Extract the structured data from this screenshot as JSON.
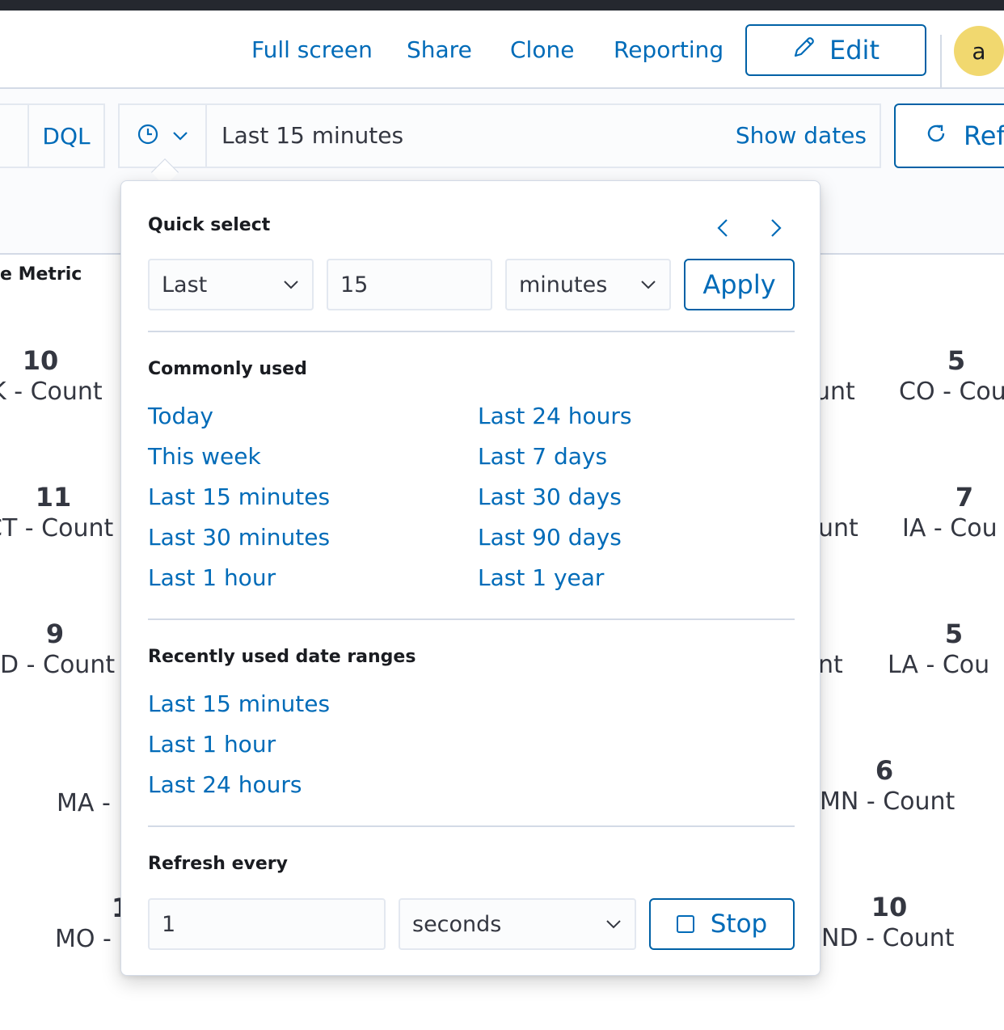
{
  "header": {
    "links": [
      "Full screen",
      "Share",
      "Clone",
      "Reporting"
    ],
    "edit_label": "Edit",
    "avatar_initial": "a"
  },
  "query_bar": {
    "language": "DQL",
    "time_range": "Last 15 minutes",
    "show_dates": "Show dates",
    "refresh_label": "Ref"
  },
  "dashboard": {
    "panel_title": "e Metric",
    "metrics": [
      {
        "value": "10",
        "label": "K - Count"
      },
      {
        "value": "11",
        "label": "CT - Count"
      },
      {
        "value": "9",
        "label": "D - Count"
      },
      {
        "value": "",
        "label": "MA -"
      },
      {
        "value": "1",
        "label": "MO -"
      },
      {
        "value": "",
        "label": "unt"
      },
      {
        "value": "",
        "label": "unt"
      },
      {
        "value": "",
        "label": "nt"
      },
      {
        "value": "6",
        "label": "MN - Count"
      },
      {
        "value": "10",
        "label": "ND - Count"
      },
      {
        "value": "5",
        "label": "CO - Cou"
      },
      {
        "value": "7",
        "label": "IA - Cou"
      },
      {
        "value": "5",
        "label": "LA - Cou"
      }
    ]
  },
  "popover": {
    "quick_select": {
      "title": "Quick select",
      "direction": "Last",
      "amount": "15",
      "unit": "minutes",
      "apply": "Apply"
    },
    "commonly_used": {
      "title": "Commonly used",
      "left": [
        "Today",
        "This week",
        "Last 15 minutes",
        "Last 30 minutes",
        "Last 1 hour"
      ],
      "right": [
        "Last 24 hours",
        "Last 7 days",
        "Last 30 days",
        "Last 90 days",
        "Last 1 year"
      ]
    },
    "recently_used": {
      "title": "Recently used date ranges",
      "items": [
        "Last 15 minutes",
        "Last 1 hour",
        "Last 24 hours"
      ]
    },
    "refresh": {
      "title": "Refresh every",
      "interval": "1",
      "unit": "seconds",
      "stop": "Stop"
    }
  },
  "colors": {
    "link": "#006bb8",
    "primary_border": "#0061a6",
    "avatar_bg": "#f1d86f",
    "top_bar": "#25282f"
  }
}
